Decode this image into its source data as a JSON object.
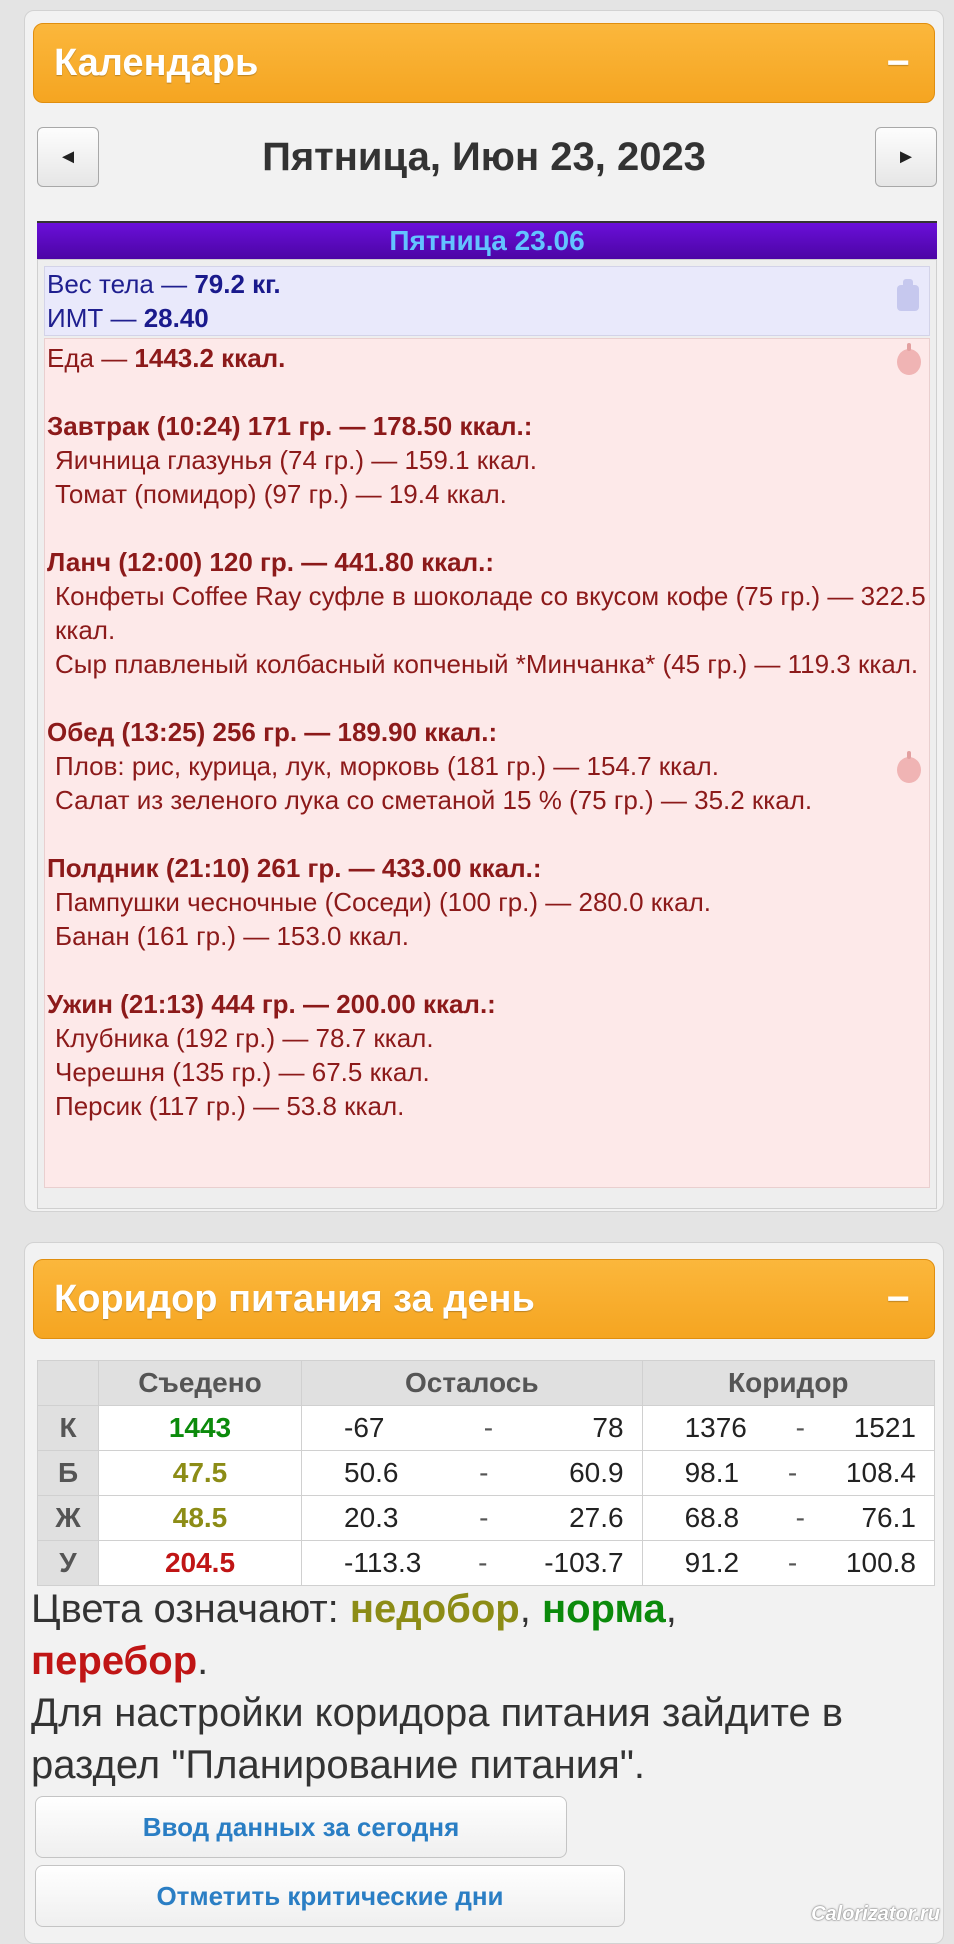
{
  "calendar": {
    "title": "Календарь",
    "collapse_icon": "−",
    "prev_icon": "◄",
    "next_icon": "►",
    "date_title": "Пятница, Июн 23, 2023",
    "day_bar": "Пятница 23.06"
  },
  "body": {
    "weight_label": "Вес тела — ",
    "weight_value": "79.2 кг.",
    "bmi_label": "ИМТ — ",
    "bmi_value": "28.40"
  },
  "food": {
    "total_label": "Еда — ",
    "total_value": "1443.2 ккал.",
    "meals": [
      {
        "title": "Завтрак (10:24) 171 гр. — 178.50 ккал.:",
        "items": [
          "Яичница глазунья (74 гр.) — 159.1 ккал.",
          "Томат (помидор) (97 гр.) — 19.4 ккал."
        ]
      },
      {
        "title": "Ланч (12:00) 120 гр. — 441.80 ккал.:",
        "items": [
          "Конфеты Coffee Ray суфле в шоколаде со вкусом кофе (75 гр.) — 322.5 ккал.",
          "Сыр плавленый колбасный копченый *Минчанка* (45 гр.) — 119.3 ккал."
        ]
      },
      {
        "title": "Обед (13:25) 256 гр. — 189.90 ккал.:",
        "items": [
          "Плов: рис, курица, лук, морковь (181 гр.) — 154.7 ккал.",
          "Салат из зеленого лука со сметаной 15 % (75 гр.) — 35.2 ккал."
        ]
      },
      {
        "title": "Полдник (21:10) 261 гр. — 433.00 ккал.:",
        "items": [
          "Пампушки чесночные (Соседи) (100 гр.) — 280.0 ккал.",
          "Банан (161 гр.) — 153.0 ккал."
        ]
      },
      {
        "title": "Ужин (21:13) 444 гр. — 200.00 ккал.:",
        "items": [
          "Клубника (192 гр.) — 78.7 ккал.",
          "Черешня (135 гр.) — 67.5 ккал.",
          "Персик (117 гр.) — 53.8 ккал."
        ]
      }
    ]
  },
  "corridor": {
    "title": "Коридор питания за день",
    "collapse_icon": "−",
    "headers": [
      "",
      "Съедено",
      "Осталось",
      "Коридор"
    ],
    "rows": [
      {
        "label": "К",
        "eaten": "1443",
        "eaten_color": "green",
        "left_min": "-67",
        "left_max": "78",
        "corr_min": "1376",
        "corr_max": "1521"
      },
      {
        "label": "Б",
        "eaten": "47.5",
        "eaten_color": "olive",
        "left_min": "50.6",
        "left_max": "60.9",
        "corr_min": "98.1",
        "corr_max": "108.4"
      },
      {
        "label": "Ж",
        "eaten": "48.5",
        "eaten_color": "olive",
        "left_min": "20.3",
        "left_max": "27.6",
        "corr_min": "68.8",
        "corr_max": "76.1"
      },
      {
        "label": "У",
        "eaten": "204.5",
        "eaten_color": "red",
        "left_min": "-113.3",
        "left_max": "-103.7",
        "corr_min": "91.2",
        "corr_max": "100.8"
      }
    ],
    "dash": "-",
    "legend_prefix": "Цвета означают: ",
    "legend_under": "недобор",
    "legend_sep1": ", ",
    "legend_norm": "норма",
    "legend_sep2": ",",
    "legend_over": "перебор",
    "legend_end": ".",
    "note": "Для настройки коридора питания зайдите в раздел \"Планирование питания\".",
    "btn_today": "Ввод данных за сегодня",
    "btn_critical": "Отметить критические дни"
  },
  "watermark": "Calorizator.ru",
  "colors": {
    "header": "#f5a521",
    "day_bar": "#5a08bd",
    "green": "#0b8a0b",
    "olive": "#8c8c16",
    "red": "#c01515"
  }
}
